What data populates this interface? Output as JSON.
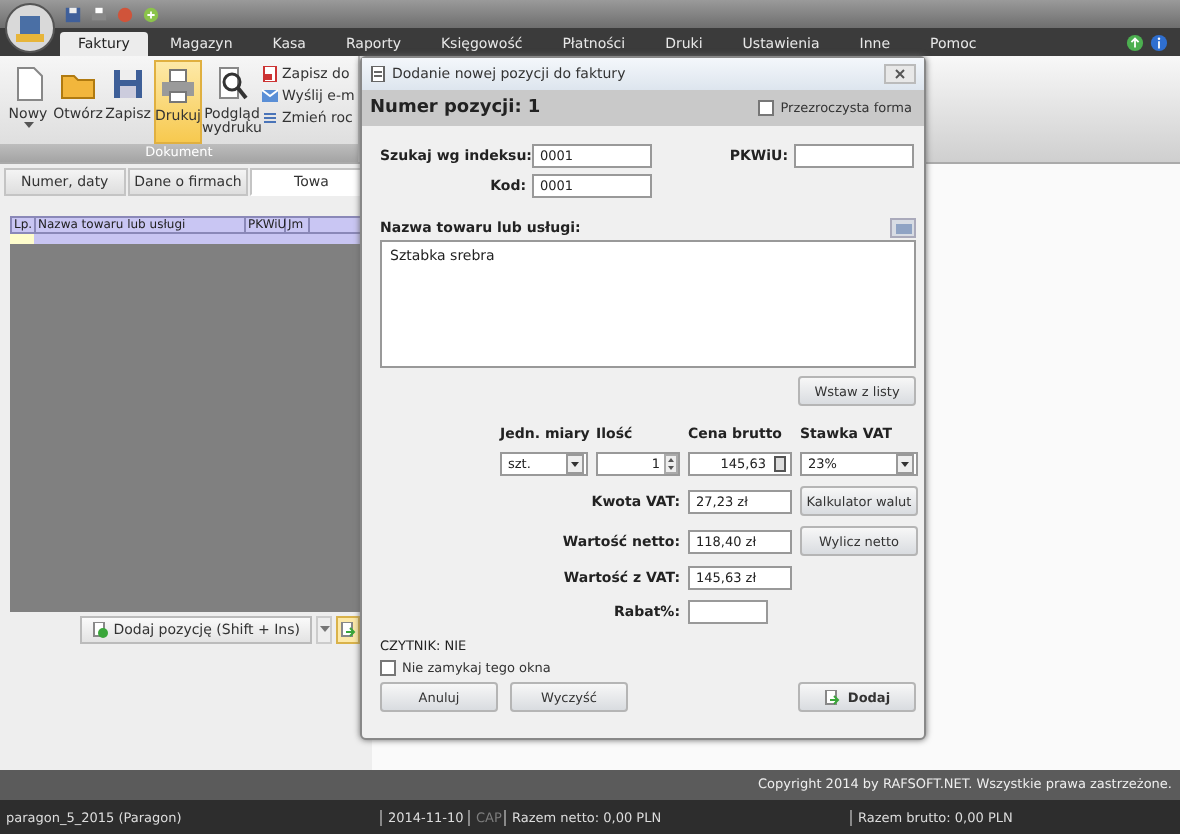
{
  "menu_tabs": [
    {
      "label": "Faktury",
      "selected": true
    },
    {
      "label": "Magazyn",
      "selected": false
    },
    {
      "label": "Kasa",
      "selected": false
    },
    {
      "label": "Raporty",
      "selected": false
    },
    {
      "label": "Księgowość",
      "selected": false
    },
    {
      "label": "Płatności",
      "selected": false
    },
    {
      "label": "Druki",
      "selected": false
    },
    {
      "label": "Ustawienia",
      "selected": false
    },
    {
      "label": "Inne",
      "selected": false
    },
    {
      "label": "Pomoc",
      "selected": false
    }
  ],
  "ribbon": {
    "buttons": [
      {
        "label": "Nowy",
        "highlighted": false
      },
      {
        "label": "Otwórz",
        "highlighted": false
      },
      {
        "label": "Zapisz",
        "highlighted": false
      },
      {
        "label": "Drukuj",
        "highlighted": true
      },
      {
        "label": "Podgląd wydruku",
        "highlighted": false
      }
    ],
    "small_buttons": [
      "Zapisz do",
      "Wyślij e-m",
      "Zmień roc"
    ],
    "group_label": "Dokument"
  },
  "doc_tabs": [
    {
      "label": "Numer, daty",
      "selected": false
    },
    {
      "label": "Dane o firmach",
      "selected": false
    },
    {
      "label": "Towa",
      "selected": true
    }
  ],
  "grid": {
    "columns": [
      "Lp.",
      "Nazwa towaru lub usługi",
      "PKWiU",
      "Jm"
    ]
  },
  "add_button": "Dodaj pozycję (Shift + Ins)",
  "copyright": "Copyright 2014 by RAFSOFT.NET. Wszystkie prawa zastrzeżone.",
  "status_bar": [
    {
      "text": "paragon_5_2015 (Paragon)",
      "disabled": false
    },
    {
      "text": "2014-11-10",
      "disabled": false
    },
    {
      "text": "CAP",
      "disabled": true
    },
    {
      "text": "Razem netto: 0,00 PLN",
      "disabled": false
    },
    {
      "text": "Razem brutto: 0,00 PLN",
      "disabled": false
    }
  ],
  "dialog": {
    "title": "Dodanie nowej pozycji do faktury",
    "position_label": "Numer pozycji:",
    "position_value": "1",
    "transparent": {
      "label": "Przezroczysta forma",
      "checked": false
    },
    "search_index": {
      "label": "Szukaj wg indeksu:",
      "value": "0001"
    },
    "code": {
      "label": "Kod:",
      "value": "0001"
    },
    "pkwiu": {
      "label": "PKWiU:"
    },
    "name_label": "Nazwa towaru lub usługi:",
    "name_value": "Sztabka srebra",
    "insert_button": "Wstaw z listy",
    "unit": {
      "label": "Jedn. miary",
      "value": "szt."
    },
    "quantity": {
      "label": "Ilość",
      "value": "1"
    },
    "price": {
      "label": "Cena brutto",
      "value": "145,63"
    },
    "vat_rate": {
      "label": "Stawka VAT",
      "value": "23%"
    },
    "vat_amount": {
      "label": "Kwota VAT:",
      "value": "27,23 zł"
    },
    "currency_button": "Kalkulator walut",
    "net_value": {
      "label": "Wartość netto:",
      "value": "118,40 zł"
    },
    "calc_net_button": "Wylicz netto",
    "gross_value": {
      "label": "Wartość z VAT:",
      "value": "145,63 zł"
    },
    "discount": {
      "label": "Rabat%:"
    },
    "reader": "CZYTNIK: NIE",
    "keep_open": {
      "label": "Nie zamykaj tego okna",
      "checked": false
    },
    "buttons": [
      "Anuluj",
      "Wyczyść",
      "Dodaj"
    ]
  }
}
